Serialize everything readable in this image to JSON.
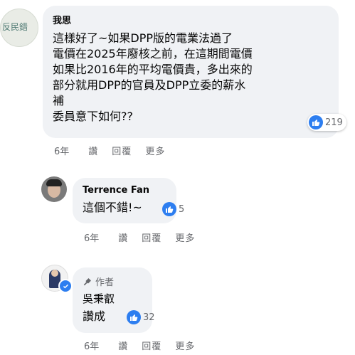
{
  "comments": [
    {
      "author": "我思",
      "avatar_text": "反民錯",
      "text": "這樣好了~如果DPP版的電業法過了\n電價在2025年廢核之前，在這期間電價\n如果比2016年的平均電價貴，多出來的\n部分就用DPP的官員及DPP立委的薪水\n補\n委員意下如何??",
      "likes": "219",
      "time": "6年",
      "like_label": "讚",
      "reply_label": "回覆",
      "more_label": "更多"
    },
    {
      "author": "Terrence Fan",
      "text": "這個不錯!~",
      "likes": "5",
      "time": "6年",
      "like_label": "讚",
      "reply_label": "回覆",
      "more_label": "更多"
    },
    {
      "author_badge": "作者",
      "author": "吳秉叡",
      "text": "讚成",
      "likes": "32",
      "time": "6年",
      "like_label": "讚",
      "reply_label": "回覆",
      "more_label": "更多"
    }
  ],
  "colors": {
    "bubble": "#f0f2f5",
    "like": "#2d7ef0",
    "meta": "#65676b"
  }
}
